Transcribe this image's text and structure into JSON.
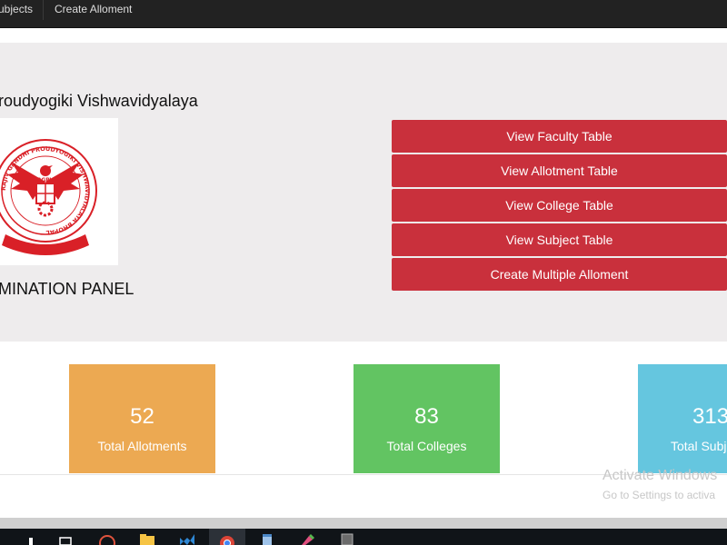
{
  "navbar": {
    "items": [
      {
        "label": "ubjects"
      },
      {
        "label": "Create Alloment"
      }
    ]
  },
  "header": {
    "university_name": "roudyogiki Vishwavidyalaya",
    "panel_title": "MINATION PANEL"
  },
  "logo": {
    "icon": "rgpv-seal-logo",
    "ring_text": "RAJIV GANDHI PROUDYOGIKI VISHWAVIDYALAYA BHOPAL",
    "est_text": "ESTD-1998",
    "center_text": "RGPV",
    "color": "#d92027"
  },
  "menu": {
    "buttons": [
      {
        "label": "View Faculty Table"
      },
      {
        "label": "View Allotment Table"
      },
      {
        "label": "View College Table"
      },
      {
        "label": "View Subject Table"
      },
      {
        "label": "Create Multiple Alloment"
      }
    ],
    "color": "#c9303c"
  },
  "stats": [
    {
      "value": "52",
      "label": "Total Allotments",
      "color": "#eca952"
    },
    {
      "value": "83",
      "label": "Total Colleges",
      "color": "#62c462"
    },
    {
      "value": "313",
      "label": "Total Subj",
      "color": "#65c6df"
    }
  ],
  "watermark": {
    "title": "Activate Windows",
    "subtitle": "Go to Settings to activa"
  },
  "taskbar": {
    "icons": [
      "windows-start-icon",
      "task-view-icon",
      "media-player-icon",
      "file-explorer-icon",
      "visual-studio-icon",
      "chrome-icon",
      "notepad-icon",
      "paint-icon",
      "terminal-icon"
    ]
  }
}
